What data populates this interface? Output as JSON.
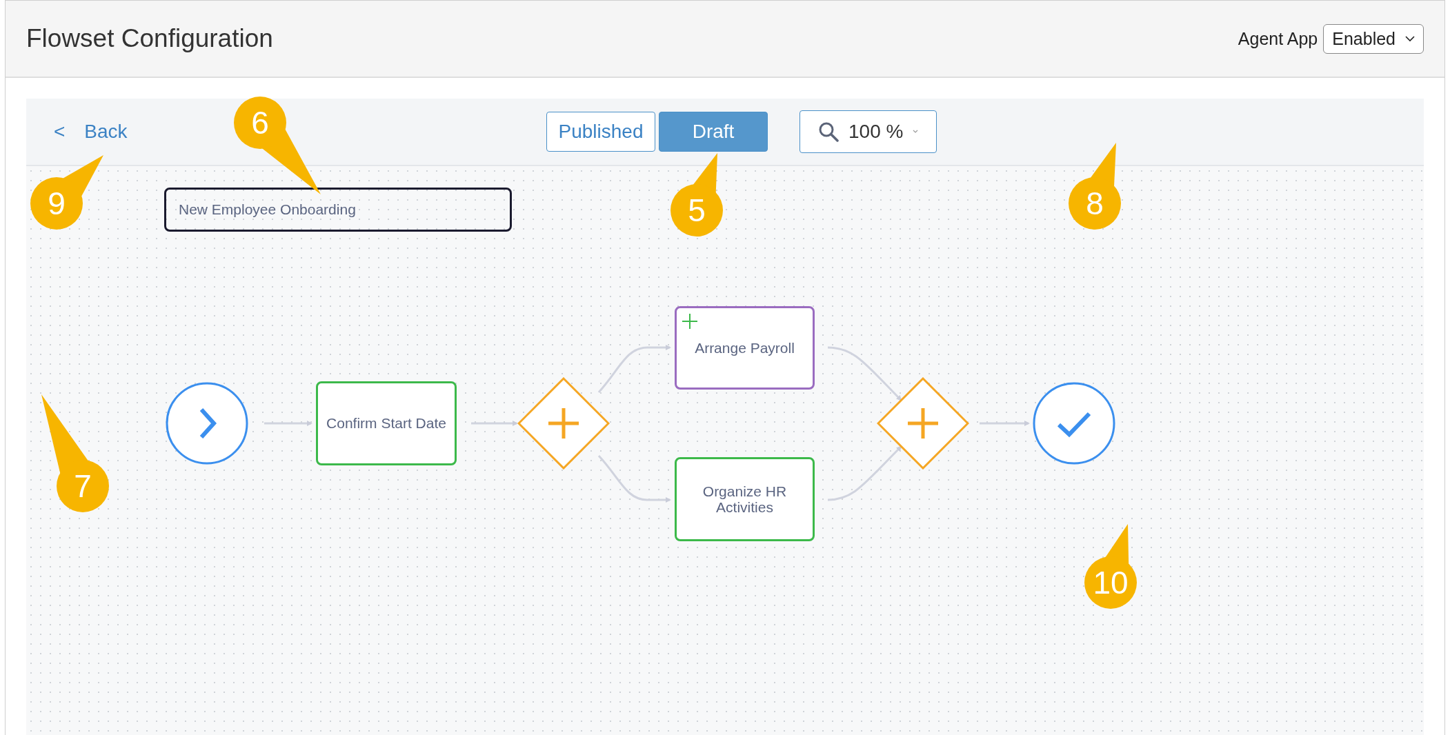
{
  "header": {
    "title": "Flowset Configuration",
    "agent_app": {
      "label": "Agent App",
      "value": "Enabled"
    }
  },
  "toolbar": {
    "back": {
      "icon": "<",
      "label": "Back"
    },
    "tabs": [
      {
        "label": "Published",
        "selected": false
      },
      {
        "label": "Draft",
        "selected": true
      }
    ],
    "zoom": "100 %"
  },
  "canvas": {
    "flow_name": "New Employee Onboarding",
    "nodes": [
      {
        "kind": "start"
      },
      {
        "kind": "task",
        "label": "Confirm Start Date",
        "color": "#3cb94a",
        "added": false
      },
      {
        "kind": "gateway"
      },
      {
        "kind": "task",
        "label": "Arrange Payroll",
        "color": "#9a6cc0",
        "added": true
      },
      {
        "kind": "task",
        "label": "Organize HR Activities",
        "color": "#3cb94a",
        "added": false
      },
      {
        "kind": "gateway"
      },
      {
        "kind": "end"
      }
    ]
  },
  "callouts": [
    "6",
    "9",
    "5",
    "8",
    "7",
    "10"
  ]
}
